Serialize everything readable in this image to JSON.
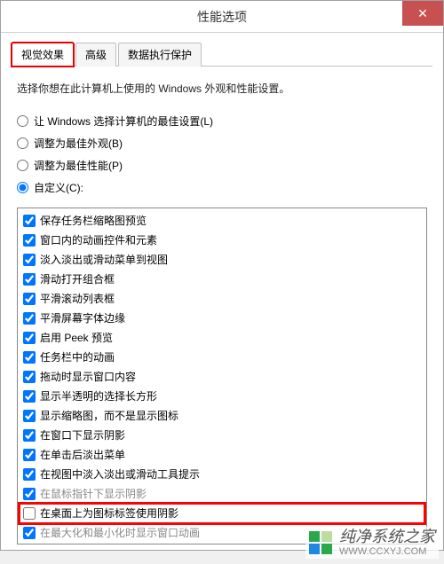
{
  "window": {
    "title": "性能选项"
  },
  "close": {
    "glyph": "✕"
  },
  "tabs": [
    {
      "label": "视觉效果",
      "active": true
    },
    {
      "label": "高级",
      "active": false
    },
    {
      "label": "数据执行保护",
      "active": false
    }
  ],
  "description": "选择你想在此计算机上使用的 Windows 外观和性能设置。",
  "radios": [
    {
      "label": "让 Windows 选择计算机的最佳设置(L)",
      "selected": false
    },
    {
      "label": "调整为最佳外观(B)",
      "selected": false
    },
    {
      "label": "调整为最佳性能(P)",
      "selected": false
    },
    {
      "label": "自定义(C):",
      "selected": true
    }
  ],
  "options": [
    {
      "label": "保存任务栏缩略图预览",
      "checked": true
    },
    {
      "label": "窗口内的动画控件和元素",
      "checked": true
    },
    {
      "label": "淡入淡出或滑动菜单到视图",
      "checked": true
    },
    {
      "label": "滑动打开组合框",
      "checked": true
    },
    {
      "label": "平滑滚动列表框",
      "checked": true
    },
    {
      "label": "平滑屏幕字体边缘",
      "checked": true
    },
    {
      "label": "启用 Peek 预览",
      "checked": true
    },
    {
      "label": "任务栏中的动画",
      "checked": true
    },
    {
      "label": "拖动时显示窗口内容",
      "checked": true
    },
    {
      "label": "显示半透明的选择长方形",
      "checked": true
    },
    {
      "label": "显示缩略图，而不是显示图标",
      "checked": true
    },
    {
      "label": "在窗口下显示阴影",
      "checked": true
    },
    {
      "label": "在单击后淡出菜单",
      "checked": true
    },
    {
      "label": "在视图中淡入淡出或滑动工具提示",
      "checked": true
    },
    {
      "label": "在鼠标指针下显示阴影",
      "checked": true,
      "dim": true
    },
    {
      "label": "在桌面上为图标标签使用阴影",
      "checked": false,
      "highlight": true
    },
    {
      "label": "在最大化和最小化时显示窗口动画",
      "checked": true,
      "dim": true
    }
  ],
  "watermark": {
    "main": "纯净系统之家",
    "sub": "WWW.CCXYJ.COM"
  }
}
